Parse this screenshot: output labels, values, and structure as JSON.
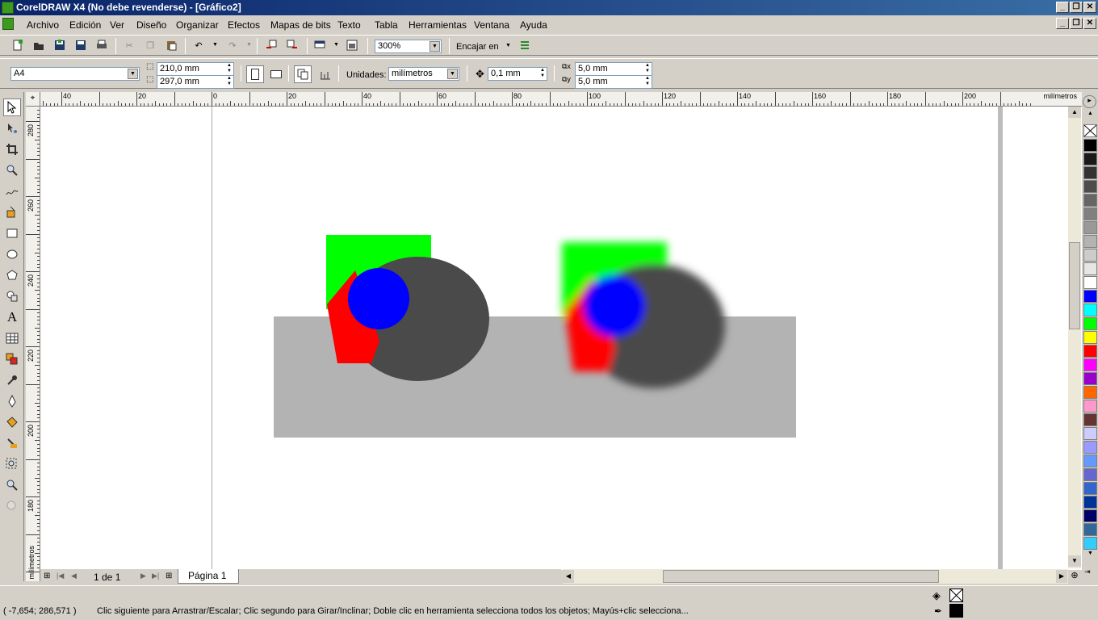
{
  "window": {
    "title": "CorelDRAW X4 (No debe revenderse) - [Gráfico2]"
  },
  "menu": [
    "Archivo",
    "Edición",
    "Ver",
    "Diseño",
    "Organizar",
    "Efectos",
    "Mapas de bits",
    "Texto",
    "Tabla",
    "Herramientas",
    "Ventana",
    "Ayuda"
  ],
  "toolbar": {
    "zoom": "300%",
    "snap_label": "Encajar en"
  },
  "propbar": {
    "page_size": "A4",
    "width": "210,0 mm",
    "height": "297,0 mm",
    "units_label": "Unidades:",
    "units": "milímetros",
    "nudge": "0,1 mm",
    "dup_x": "5,0 mm",
    "dup_y": "5,0 mm"
  },
  "ruler": {
    "unit": "milímetros",
    "h_labels": [
      "40",
      "20",
      "0",
      "20",
      "40",
      "60",
      "80",
      "100",
      "120",
      "140",
      "160",
      "180",
      "200"
    ],
    "v_labels": [
      "280",
      "260",
      "240",
      "220",
      "200",
      "180"
    ],
    "v_unit": "milímetros"
  },
  "pagebar": {
    "counter": "1 de 1",
    "tab": "Página 1"
  },
  "status": {
    "coords": "( -7,654; 286,571 )",
    "hint": "Clic siguiente para Arrastrar/Escalar; Clic segundo para Girar/Inclinar; Doble clic en herramienta selecciona todos los objetos; Mayús+clic selecciona..."
  },
  "palette": [
    "#000000",
    "#1a1a1a",
    "#333333",
    "#4d4d4d",
    "#666666",
    "#808080",
    "#999999",
    "#b3b3b3",
    "#cccccc",
    "#e6e6e6",
    "#ffffff",
    "#0000ff",
    "#00ffff",
    "#00ff00",
    "#ffff00",
    "#ff0000",
    "#ff00ff",
    "#9900cc",
    "#ff6600",
    "#ff99cc",
    "#663333",
    "#ccccff",
    "#9999ff",
    "#6699ff",
    "#6666cc",
    "#3366cc",
    "#003399",
    "#000066",
    "#336699",
    "#33ccff"
  ],
  "colors": {
    "green": "#00ff00",
    "blue": "#0000ff",
    "red": "#ff0000",
    "dark": "#4a4a4a",
    "gray": "#b3b3b3"
  }
}
